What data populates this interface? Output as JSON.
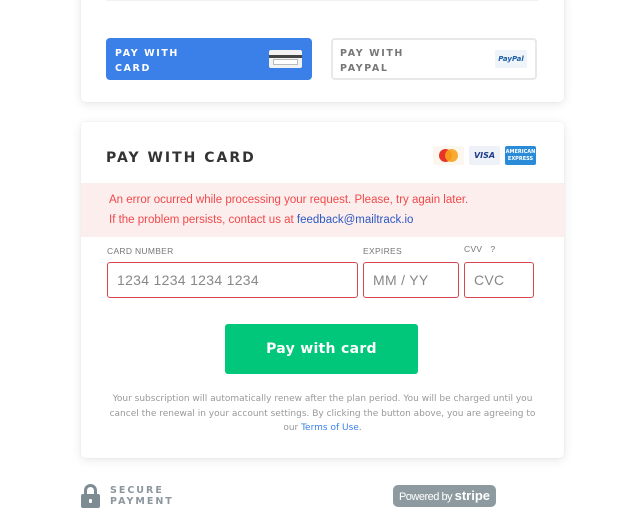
{
  "payment_methods": {
    "card": {
      "label": "PAY WITH CARD",
      "icon": "credit-card-icon",
      "selected": true
    },
    "paypal": {
      "label": "PAY WITH PAYPAL",
      "icon": "paypal-logo",
      "badge_text": "PayPal",
      "selected": false
    }
  },
  "main": {
    "title": "PAY WITH CARD",
    "brands": [
      {
        "name": "mastercard",
        "text": ""
      },
      {
        "name": "visa",
        "text": "VISA"
      },
      {
        "name": "amex",
        "text": "AMERICAN EXPRESS"
      }
    ],
    "error": {
      "line1": "An error ocurred while processing your request. Please, try again later.",
      "line2_prefix": "If the problem persists, contact us at ",
      "email": "feedback@mailtrack.io",
      "color": "#f0494a"
    },
    "fields": {
      "card_number": {
        "label": "CARD NUMBER",
        "placeholder": "1234 1234 1234 1234"
      },
      "expires": {
        "label": "EXPIRES",
        "placeholder": "MM / YY"
      },
      "cvv": {
        "label": "CVV",
        "help": "?",
        "placeholder": "CVC"
      }
    },
    "pay_button": {
      "label": "Pay with card",
      "color": "#00c77a"
    },
    "legal": {
      "text": "Your subscription will automatically renew after the plan period. You will be charged until you cancel the renewal in your account settings. By clicking the button above, you are agreeing to our ",
      "link": "Terms of Use."
    }
  },
  "footer": {
    "secure_line1": "SECURE",
    "secure_line2": "PAYMENT",
    "powered_prefix": "Powered by ",
    "powered_brand": "stripe"
  },
  "colors": {
    "accent": "#3a80e8",
    "error_border": "#d9464f"
  }
}
